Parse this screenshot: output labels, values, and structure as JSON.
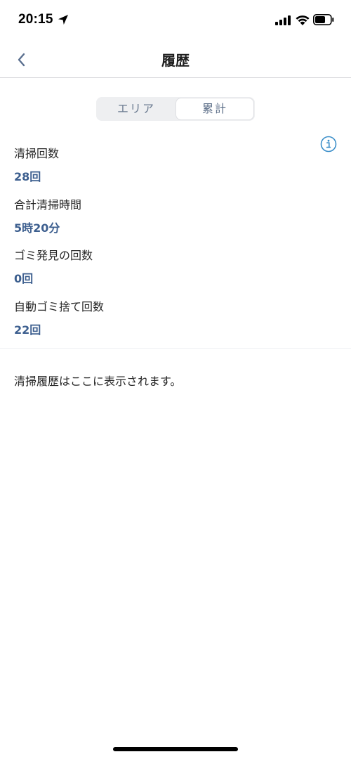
{
  "status_bar": {
    "time": "20:15",
    "location_icon": "location-arrow-icon",
    "signal_icon": "cellular-signal-icon",
    "wifi_icon": "wifi-icon",
    "battery_icon": "battery-icon"
  },
  "nav": {
    "back_icon": "chevron-left-icon",
    "title": "履歴"
  },
  "segments": {
    "items": [
      "エリア",
      "累計"
    ],
    "selected": "累計"
  },
  "info_icon": "info-icon",
  "stats": [
    {
      "label": "清掃回数",
      "value": "28回"
    },
    {
      "label": "合計清掃時間",
      "value": "5時20分"
    },
    {
      "label": "ゴミ発見の回数",
      "value": "0回"
    },
    {
      "label": "自動ゴミ捨て回数",
      "value": "22回"
    }
  ],
  "history": {
    "empty_message": "清掃履歴はここに表示されます。"
  },
  "colors": {
    "accent_value": "#3d5f8f",
    "info_icon": "#3a8ec9",
    "back_chevron": "#5a6f8f"
  }
}
